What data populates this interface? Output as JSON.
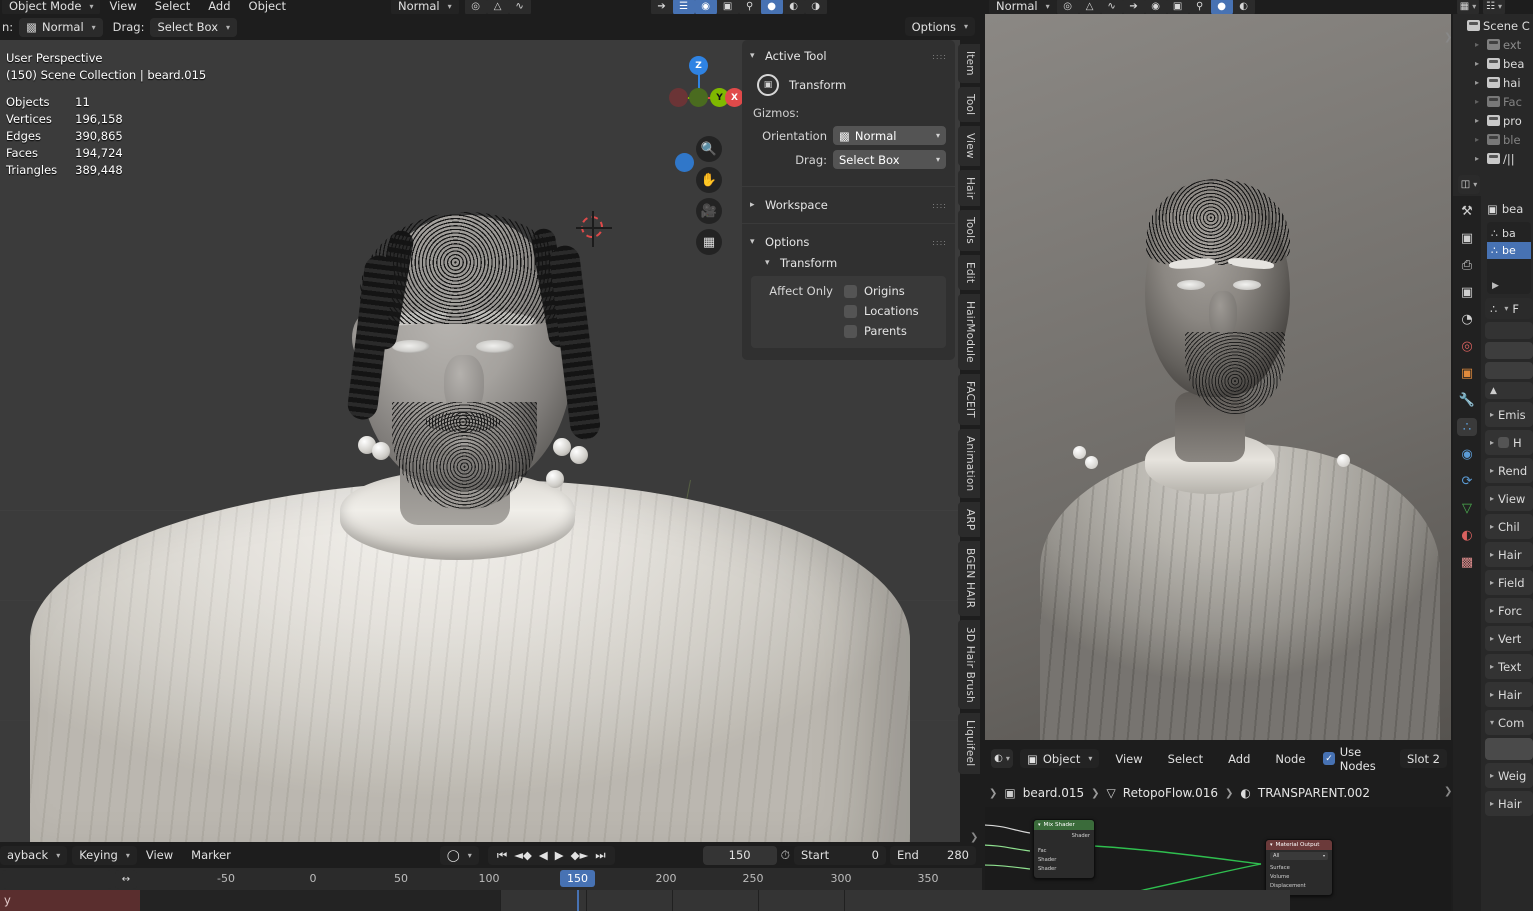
{
  "app": {
    "name": "Blender",
    "theme_bg": "#1d1d1d",
    "accent": "#4772b3"
  },
  "topbar": {
    "mode": "Object Mode",
    "menus": [
      "View",
      "Select",
      "Add",
      "Object"
    ],
    "orientation_label": "Normal",
    "options_label": "Options"
  },
  "toolrow": {
    "orientation_prefix": "n:",
    "orientation_value": "Normal",
    "drag_label": "Drag:",
    "drag_value": "Select Box"
  },
  "viewport": {
    "perspective": "User Perspective",
    "scene_line": "(150) Scene Collection | beard.015",
    "stats": [
      {
        "label": "Objects",
        "value": "11"
      },
      {
        "label": "Vertices",
        "value": "196,158"
      },
      {
        "label": "Edges",
        "value": "390,865"
      },
      {
        "label": "Faces",
        "value": "194,724"
      },
      {
        "label": "Triangles",
        "value": "389,448"
      }
    ],
    "gizmo_axes": [
      {
        "label": "Z",
        "color": "#2f83e3"
      },
      {
        "label": "Y",
        "color": "#7fb800"
      },
      {
        "label": "X",
        "color": "#e04a4a"
      }
    ],
    "nav_buttons": [
      "zoom-icon",
      "hand-icon",
      "camera-icon",
      "grid-icon"
    ]
  },
  "npanel": {
    "active_tool": {
      "title": "Active Tool",
      "tool_name": "Transform"
    },
    "gizmos_label": "Gizmos:",
    "orientation_label": "Orientation",
    "orientation_value": "Normal",
    "drag_label": "Drag:",
    "drag_value": "Select Box",
    "workspace_title": "Workspace",
    "options_title": "Options",
    "transform_title": "Transform",
    "affect_only_label": "Affect Only",
    "checkboxes": [
      {
        "label": "Origins",
        "checked": false
      },
      {
        "label": "Locations",
        "checked": false
      },
      {
        "label": "Parents",
        "checked": false
      }
    ]
  },
  "tabstrip": {
    "tabs": [
      "Item",
      "Tool",
      "View",
      "Hair",
      "Tools",
      "Edit",
      "HairModule",
      "FACEIT",
      "Animation",
      "ARP",
      "BGEN HAIR",
      "3D Hair Brush",
      "Liquifeel"
    ]
  },
  "shader_editor": {
    "shading_type": "Object",
    "menus": [
      "View",
      "Select",
      "Add",
      "Node"
    ],
    "use_nodes_label": "Use Nodes",
    "use_nodes_checked": true,
    "slot_label": "Slot 2",
    "breadcrumb": [
      "beard.015",
      "RetopoFlow.016",
      "TRANSPARENT.002"
    ],
    "nodes": [
      {
        "title": "Mix Shader",
        "header_color": "#3a6b3a",
        "outputs": [
          "Shader"
        ],
        "inputs": [
          "Fac",
          "Shader",
          "Shader"
        ]
      },
      {
        "title": "Material Output",
        "header_color": "#6b3a3a",
        "target": "All",
        "inputs": [
          "Surface",
          "Volume",
          "Displacement"
        ]
      }
    ]
  },
  "timeline": {
    "menus": [
      "ayback",
      "Keying",
      "View",
      "Marker"
    ],
    "current_frame": "150",
    "start_label": "Start",
    "start_value": "0",
    "end_label": "End",
    "end_value": "280",
    "ruler_ticks": [
      "-50",
      "0",
      "50",
      "100",
      "150",
      "200",
      "250",
      "300",
      "350"
    ],
    "transport": [
      "jump-start-icon",
      "prev-keyframe-icon",
      "play-reverse-icon",
      "play-icon",
      "next-keyframe-icon",
      "jump-end-icon"
    ]
  },
  "outliner": {
    "scene_label": "Scene C",
    "items": [
      {
        "label": "ext",
        "dim": true
      },
      {
        "label": "bea",
        "dim": false
      },
      {
        "label": "hai",
        "dim": false
      },
      {
        "label": "Fac",
        "dim": true
      },
      {
        "label": "pro",
        "dim": false
      },
      {
        "label": "ble",
        "dim": true
      },
      {
        "label": "/||",
        "dim": false
      }
    ]
  },
  "properties": {
    "object_name": "bea",
    "particle_list": [
      {
        "label": "ba",
        "selected": false
      },
      {
        "label": "be",
        "selected": true
      }
    ],
    "tabs": [
      {
        "name": "tool-tab",
        "glyph": "⚒",
        "color": "#cfcfcf",
        "active": false
      },
      {
        "name": "render-tab",
        "glyph": "▣",
        "color": "#cfcfcf",
        "active": false
      },
      {
        "name": "output-tab",
        "glyph": "⎙",
        "color": "#cfcfcf",
        "active": false
      },
      {
        "name": "view-layer-tab",
        "glyph": "❑",
        "color": "#cfcfcf",
        "active": false
      },
      {
        "name": "scene-tab",
        "glyph": "◔",
        "color": "#cfcfcf",
        "active": false
      },
      {
        "name": "world-tab",
        "glyph": "◎",
        "color": "#d9615f",
        "active": false
      },
      {
        "name": "object-tab",
        "glyph": "▣",
        "color": "#e08a3c",
        "active": false
      },
      {
        "name": "modifier-tab",
        "glyph": "ᴧ",
        "color": "#4f8ada",
        "active": false
      },
      {
        "name": "particles-tab",
        "glyph": "∴",
        "color": "#5b9bd5",
        "active": true
      },
      {
        "name": "physics-tab",
        "glyph": "◌",
        "color": "#5b9bd5",
        "active": false
      },
      {
        "name": "constraints-tab",
        "glyph": "⟳",
        "color": "#5b9bd5",
        "active": false
      },
      {
        "name": "data-tab",
        "glyph": "▽",
        "color": "#4caf50",
        "active": false
      },
      {
        "name": "material-tab",
        "glyph": "◕",
        "color": "#d9615f",
        "active": false
      },
      {
        "name": "texture-tab",
        "glyph": "▒",
        "color": "#d98a8a",
        "active": false
      }
    ],
    "panels": [
      "Emis",
      "H",
      "Rend",
      "View",
      "Chil",
      "Hair",
      "Field",
      "Forc",
      "Vert",
      "Text",
      "Hair",
      "Com",
      "Weig",
      "Hair"
    ]
  }
}
